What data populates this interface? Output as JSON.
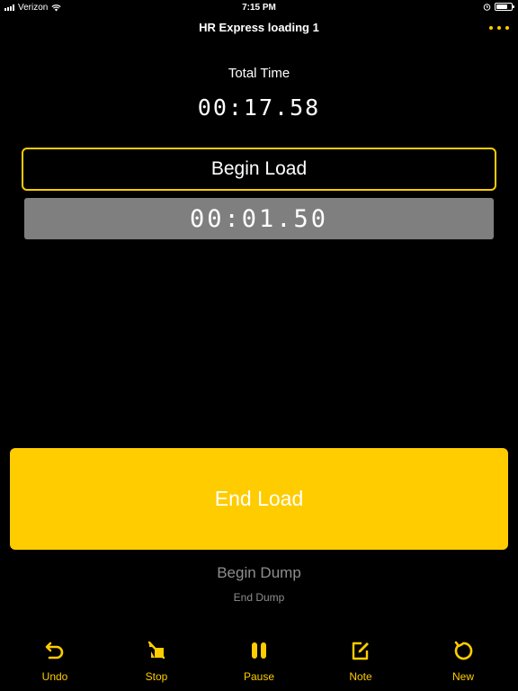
{
  "status_bar": {
    "carrier": "Verizon",
    "time": "7:15 PM"
  },
  "nav": {
    "title": "HR Express loading 1",
    "more_icon": "ellipsis-icon"
  },
  "total": {
    "label": "Total Time",
    "value": "00:17.58"
  },
  "current_step": {
    "label": "Begin Load",
    "split_time": "00:01.50"
  },
  "action": {
    "label": "End Load"
  },
  "upcoming": {
    "next": "Begin Dump",
    "after": "End Dump"
  },
  "toolbar": {
    "items": [
      {
        "label": "Undo",
        "icon": "undo-icon"
      },
      {
        "label": "Stop",
        "icon": "stop-icon"
      },
      {
        "label": "Pause",
        "icon": "pause-icon"
      },
      {
        "label": "Note",
        "icon": "note-icon"
      },
      {
        "label": "New",
        "icon": "new-icon"
      }
    ]
  },
  "colors": {
    "accent": "#FFCC00",
    "background": "#000000",
    "split_bg": "#7F7F7F",
    "muted_text": "#8E8E8E"
  }
}
